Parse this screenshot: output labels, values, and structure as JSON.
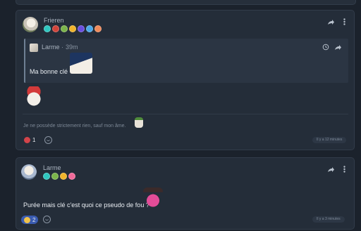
{
  "colors": {
    "background": "#1b222c",
    "card": "#242d39",
    "quote": "#2b3543",
    "accent": "#3a5bb0"
  },
  "messages": [
    {
      "username": "Frieren",
      "badges": [
        {
          "icon": "diamond-badge-icon",
          "color": "#2fc7c0"
        },
        {
          "icon": "flame-badge-icon",
          "color": "#d2443a"
        },
        {
          "icon": "leaf-badge-icon",
          "color": "#7bb44a"
        },
        {
          "icon": "smile-badge-icon",
          "color": "#f0b42b"
        },
        {
          "icon": "bolt-badge-icon",
          "color": "#6a4ee0"
        },
        {
          "icon": "gem-badge-icon",
          "color": "#4aa8e8"
        },
        {
          "icon": "star-badge-icon",
          "color": "#f08a5a"
        }
      ],
      "quote": {
        "author": "Larme",
        "time": "39m",
        "text": "Ma bonne clé"
      },
      "status": "Je ne possède strictement rien, sauf mon âme.",
      "reactions": [
        {
          "emoji": "laugh-emoji",
          "count": "1"
        }
      ],
      "timestamp": "Il y a 12 minutes"
    },
    {
      "username": "Larme",
      "badges": [
        {
          "icon": "diamond-badge-icon",
          "color": "#2fc7c0"
        },
        {
          "icon": "leaf-badge-icon",
          "color": "#7bb44a"
        },
        {
          "icon": "smile-badge-icon",
          "color": "#f0b42b"
        },
        {
          "icon": "heart-badge-icon",
          "color": "#f06a9a"
        }
      ],
      "text": "Purée mais clé c'est quoi ce pseudo de fou ?",
      "reactions": [
        {
          "emoji": "thumbs-up-emoji",
          "count": "2"
        }
      ],
      "timestamp": "Il y a 3 minutes"
    }
  ]
}
